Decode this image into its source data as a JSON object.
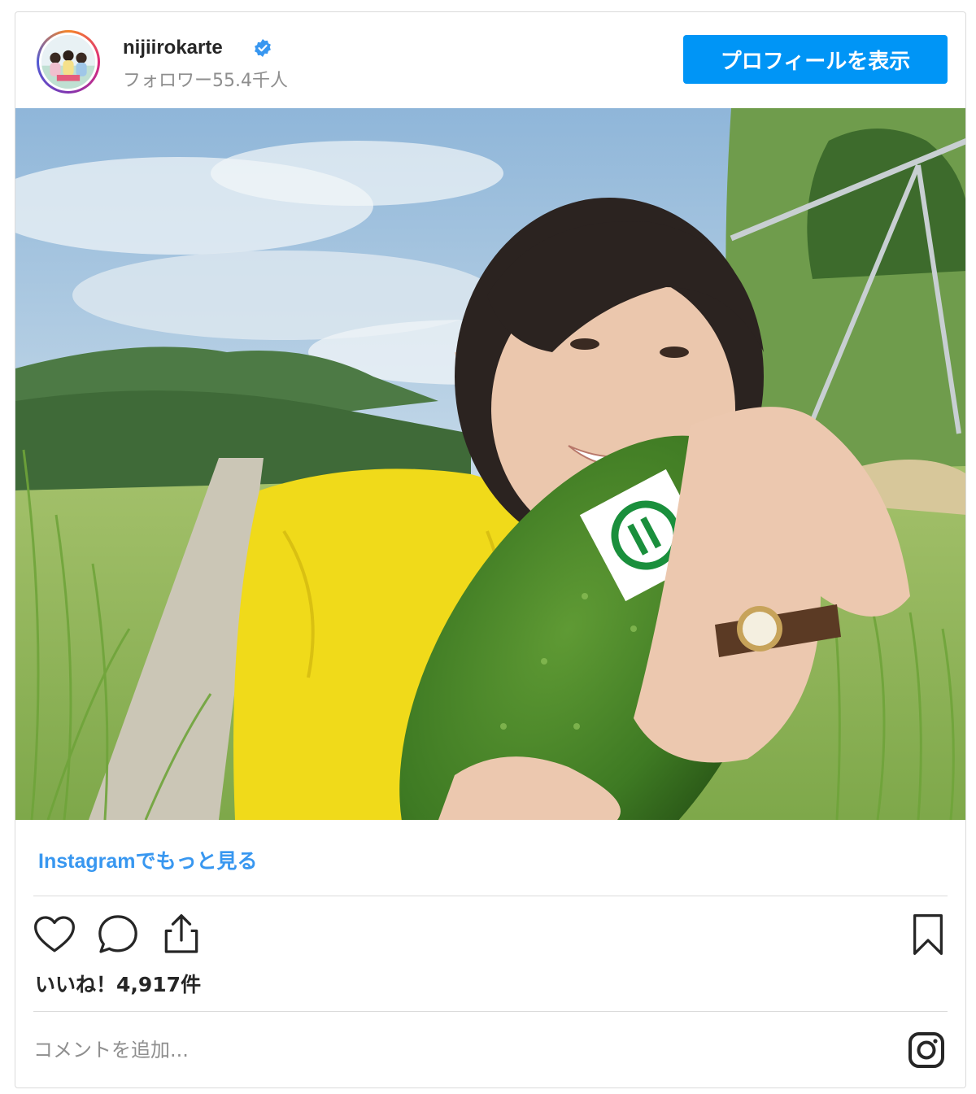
{
  "header": {
    "username": "nijiirokarte",
    "followers": "フォロワー55.4千人",
    "profile_button": "プロフィールを表示"
  },
  "post": {
    "more_link": "Instagramでもっと見る",
    "likes": "いいね！4,917件",
    "comment_placeholder": "コメントを追加..."
  },
  "icons": {
    "verified": "verified-badge-icon",
    "like": "heart-icon",
    "comment": "comment-bubble-icon",
    "share": "share-icon",
    "save": "bookmark-icon",
    "instagram": "instagram-logo-icon"
  },
  "colors": {
    "primary_button": "#0095f6",
    "link": "#3897f0",
    "secondary_text": "#8e8e8e",
    "border": "#dbdbdb"
  }
}
